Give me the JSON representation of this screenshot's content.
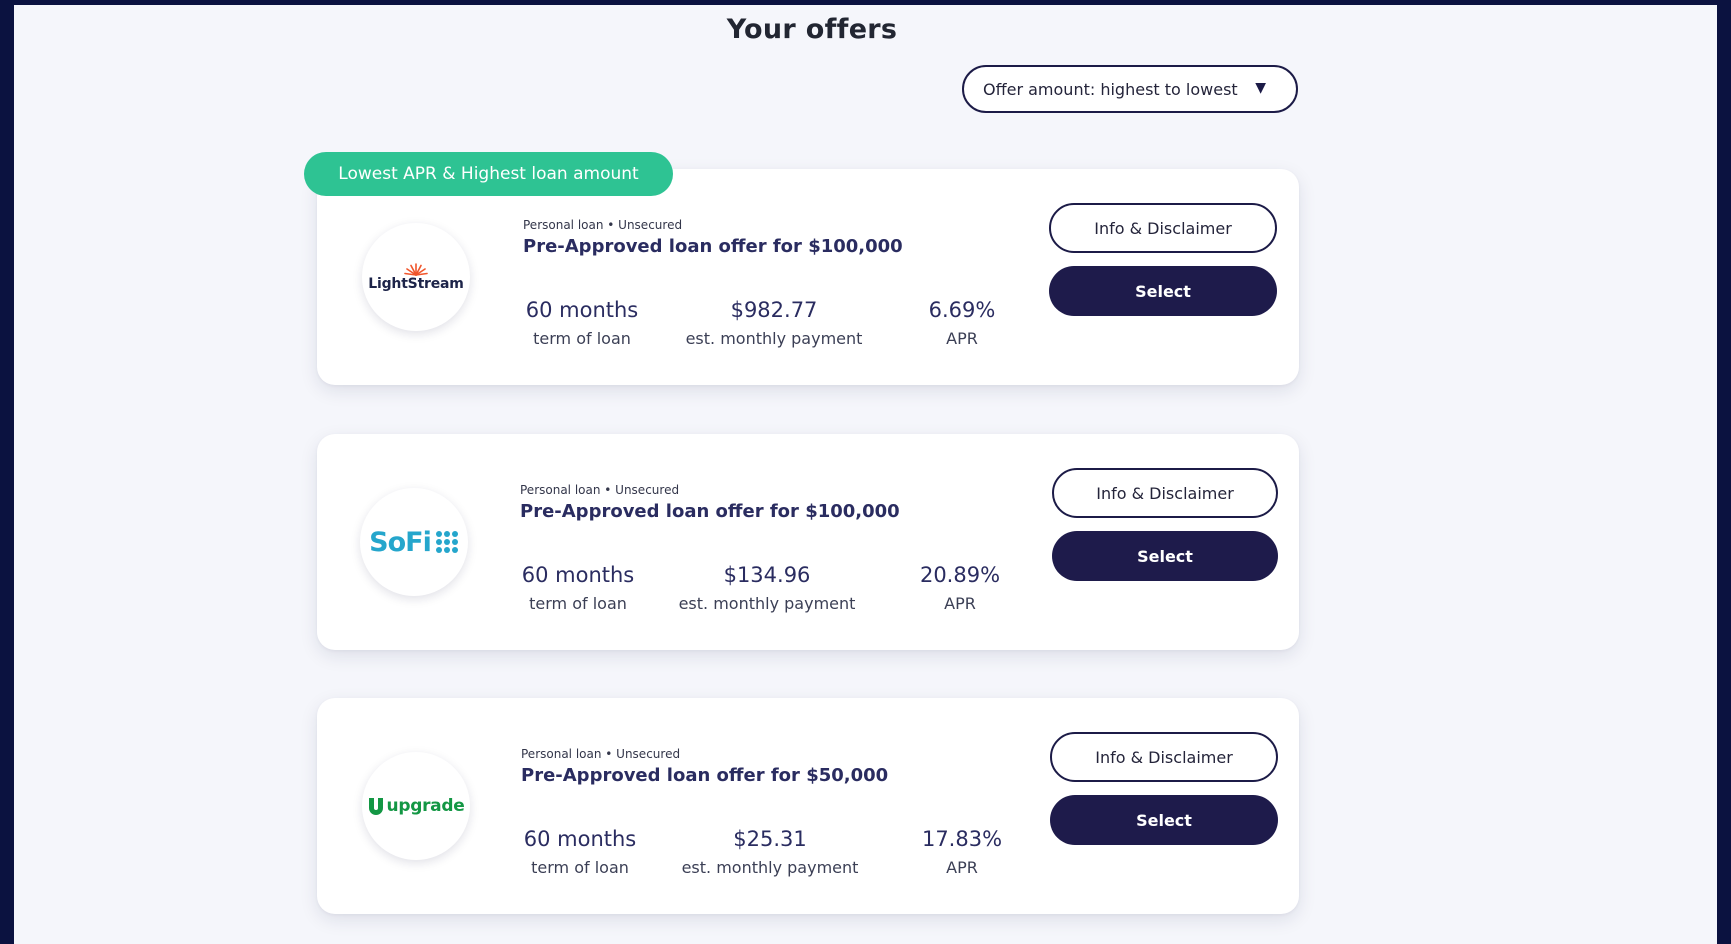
{
  "page": {
    "title": "Your offers"
  },
  "sort": {
    "selected": "Offer amount: highest to lowest"
  },
  "offers": [
    {
      "badge": "Lowest APR & Highest loan amount",
      "lender": "LightStream",
      "loan_type": "Personal loan • Unsecured",
      "title": "Pre-Approved loan offer for $100,000",
      "term": "60 months",
      "term_label": "term of loan",
      "payment": "$982.77",
      "payment_label": "est. monthly payment",
      "apr": "6.69%",
      "apr_label": "APR",
      "info_label": "Info & Disclaimer",
      "select_label": "Select"
    },
    {
      "lender": "SoFi",
      "loan_type": "Personal loan • Unsecured",
      "title": "Pre-Approved loan offer for $100,000",
      "term": "60 months",
      "term_label": "term of loan",
      "payment": "$134.96",
      "payment_label": "est. monthly payment",
      "apr": "20.89%",
      "apr_label": "APR",
      "info_label": "Info & Disclaimer",
      "select_label": "Select"
    },
    {
      "lender": "upgrade",
      "loan_type": "Personal loan • Unsecured",
      "title": "Pre-Approved loan offer for $50,000",
      "term": "60 months",
      "term_label": "term of loan",
      "payment": "$25.31",
      "payment_label": "est. monthly payment",
      "apr": "17.83%",
      "apr_label": "APR",
      "info_label": "Info & Disclaimer",
      "select_label": "Select"
    }
  ],
  "colors": {
    "navy": "#1e1b4b",
    "badge_green": "#2ec393",
    "sofi_blue": "#25a6cc",
    "upgrade_green": "#139744",
    "lightstream_orange": "#f0552b"
  }
}
